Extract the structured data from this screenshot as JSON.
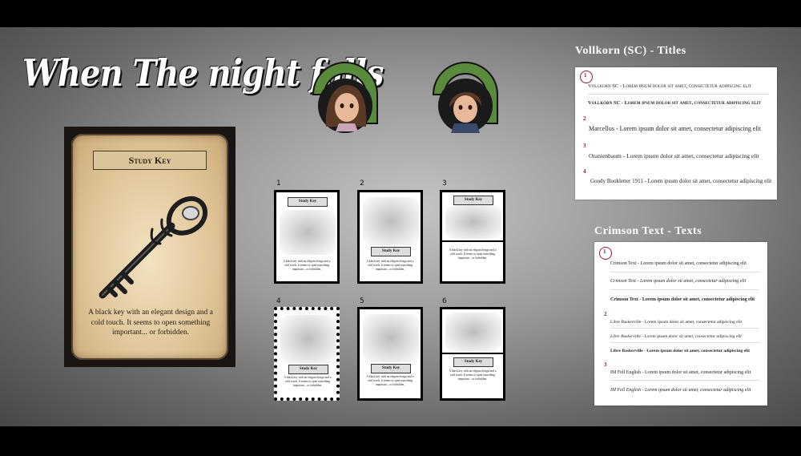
{
  "logo": {
    "text": "When The night falls"
  },
  "big_card": {
    "title": "Study Key",
    "text": "A black key with an elegant design and a cold touch. It seems to open something important... or forbidden."
  },
  "mini_cards": [
    {
      "num": "1",
      "title": "Study Key",
      "text": "A black key with an elegant design and a cold touch. It seems to open something important... or forbidden."
    },
    {
      "num": "2",
      "title": "Study Key",
      "text": "A black key with an elegant design and a cold touch. It seems to open something important... or forbidden."
    },
    {
      "num": "3",
      "title": "Study Key",
      "text": "A black key with an elegant design and a cold touch. It seems to open something important... or forbidden."
    },
    {
      "num": "4",
      "title": "Study Key",
      "text": "A black key with an elegant design and a cold touch. It seems to open something important... or forbidden."
    },
    {
      "num": "5",
      "title": "Study Key",
      "text": "A black key with an elegant design and a cold touch. It seems to open something important... or forbidden."
    },
    {
      "num": "6",
      "title": "Study Key",
      "text": "A black key with an elegant design and a cold touch. It seems to open something important... or forbidden."
    }
  ],
  "titles_panel": {
    "heading": "Vollkorn (SC) - Titles",
    "rows": [
      {
        "num": "1",
        "sample": "Vollkorn SC - Lorem ipsum dolor sit amet, consectetur adipiscing elit"
      },
      {
        "num": "",
        "sample": "Vollkorn SC - Lorem ipsum dolor sit amet, consectetur adipiscing elit"
      },
      {
        "num": "2",
        "sample": "Marcellus - Lorem ipsum dolor sit amet, consectetur adipiscing elit"
      },
      {
        "num": "3",
        "sample": "Oranienbaum - Lorem ipsum dolor sit amet, consectetur adipiscing elit"
      },
      {
        "num": "4",
        "sample": "Goudy Bookletter 1911 - Lorem ipsum dolor sit amet, consectetur adipiscing elit"
      }
    ]
  },
  "texts_panel": {
    "heading": "Crimson Text - Texts",
    "rows": [
      {
        "num": "1",
        "sample": "Crimson Text - Lorem ipsum dolor sit amet, consectetur adipiscing elit"
      },
      {
        "num": "",
        "sample": "Crimson Text - Lorem ipsum dolor sit amet, consectetur adipiscing elit"
      },
      {
        "num": "",
        "sample": "Crimson Text - Lorem ipsum dolor sit amet, consectetur adipiscing elit"
      },
      {
        "num": "2",
        "sample": "Libre Baskerville - Lorem ipsum dolor sit amet, consectetur adipiscing elit"
      },
      {
        "num": "",
        "sample": "Libre Baskerville - Lorem ipsum dolor sit amet, consectetur adipiscing elit"
      },
      {
        "num": "",
        "sample": "Libre Baskerville - Lorem ipsum dolor sit amet, consectetur adipiscing elit"
      },
      {
        "num": "3",
        "sample": "IM Fell English - Lorem ipsum dolor sit amet, consectetur adipiscing elit"
      },
      {
        "num": "",
        "sample": "IM Fell English - Lorem ipsum dolor sit amet, consectetur adipiscing elit"
      }
    ]
  },
  "colors": {
    "accent_green": "#5a8a3c",
    "accent_red": "#8b1a3a",
    "parchment": "#e0c69a"
  }
}
